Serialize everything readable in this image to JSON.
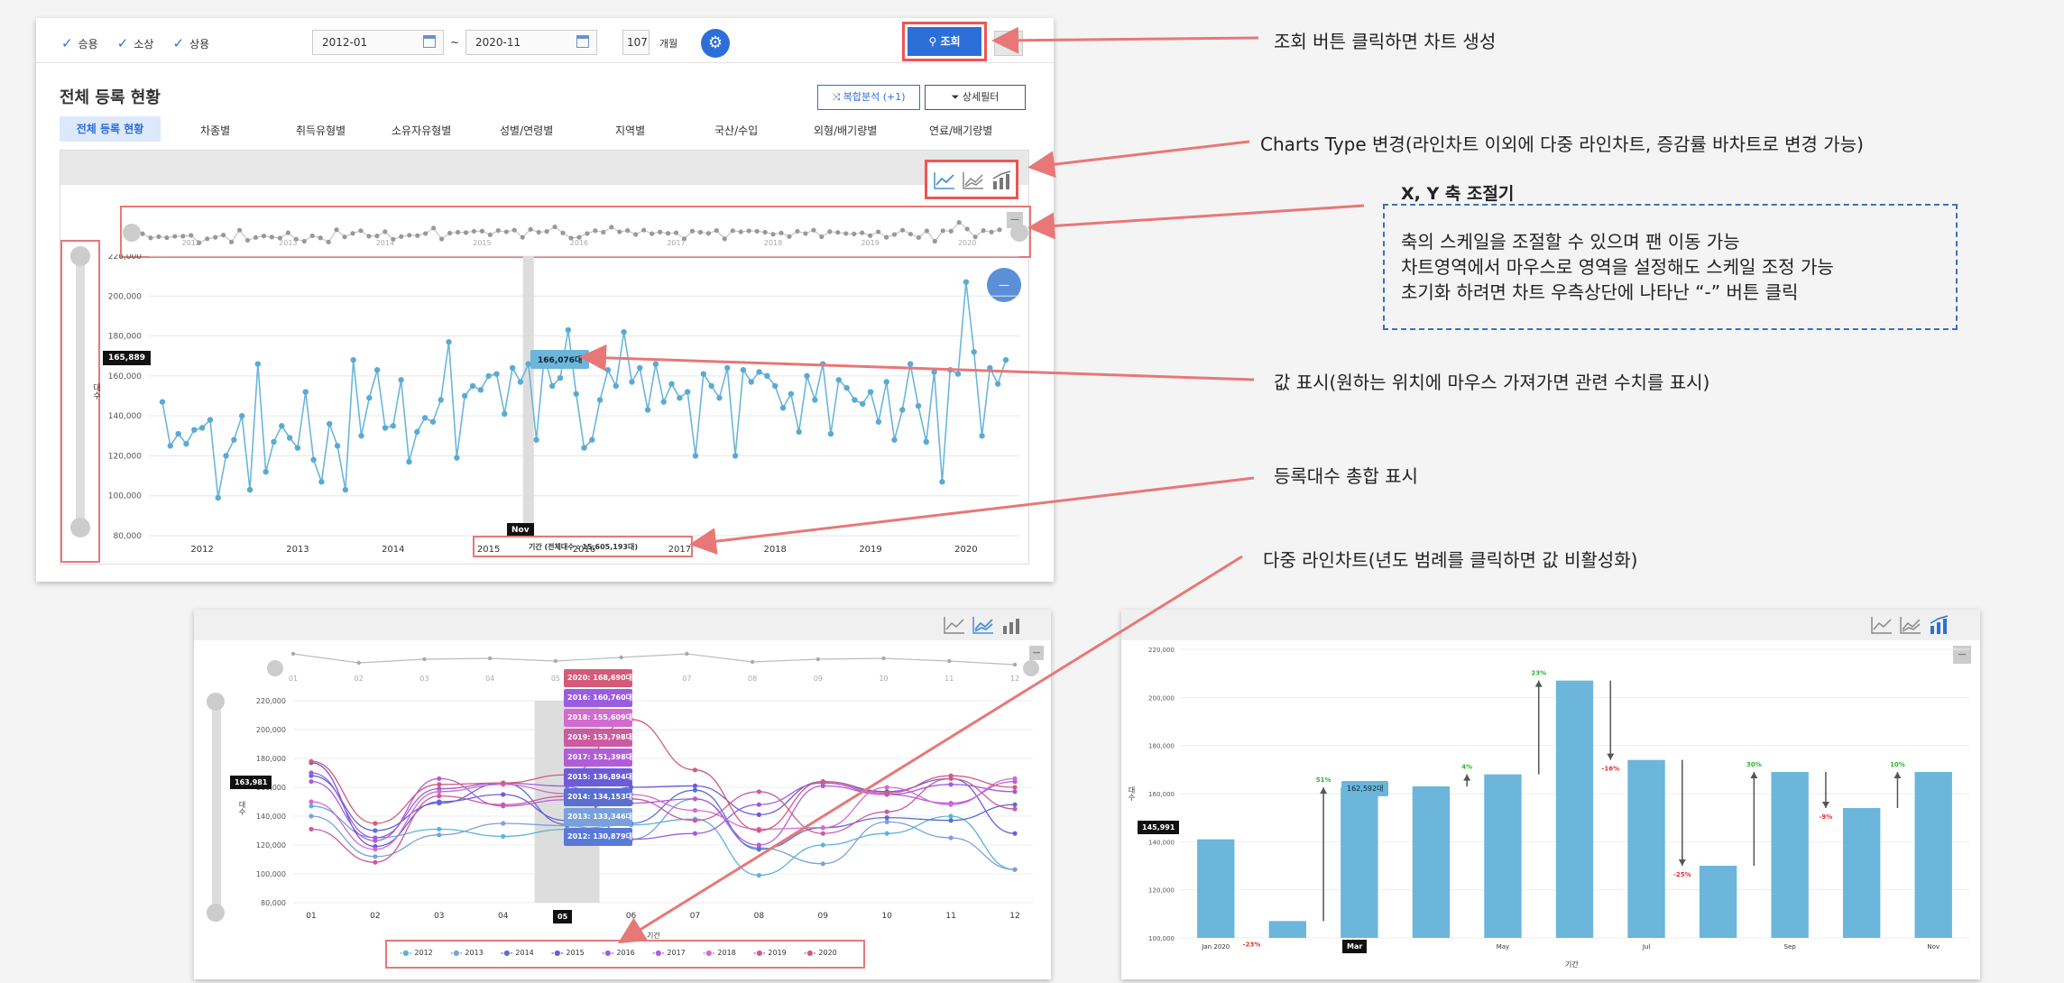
{
  "filters": {
    "checkboxes": [
      "승용",
      "소상",
      "상용"
    ],
    "start_date": "2012-01",
    "tilde": "~",
    "end_date": "2020-11",
    "months_value": "107",
    "months_unit": "개월",
    "search_label": "조회",
    "accent": "#2d6fd8"
  },
  "panel": {
    "title": "전체 등록 현황",
    "compound_label": "복합분석 (+1)",
    "detail_filter_label": "상세필터",
    "tabs": [
      "전체 등록 현황",
      "차종별",
      "취득유형별",
      "소유자유형별",
      "성별/연령별",
      "지역별",
      "국산/수입",
      "외형/배기량별",
      "연료/배기량별"
    ]
  },
  "main_chart": {
    "y_ticks": [
      "220,000",
      "200,000",
      "180,000",
      "160,000",
      "140,000",
      "120,000",
      "100,000",
      "80,000"
    ],
    "x_ticks": [
      "2012",
      "2013",
      "2014",
      "2015",
      "2016",
      "2017",
      "2018",
      "2019",
      "2020"
    ],
    "nav_labels": [
      "2012",
      "2013",
      "2014",
      "2015",
      "2016",
      "2017",
      "2018",
      "2019",
      "2020"
    ],
    "cursor_label": "Nov",
    "y_cursor_value": "165,889",
    "tooltip": "166,076대",
    "y_axis_title": "대수",
    "x_axis_title": "기간 (전체대수 : 15,605,193대)",
    "reset_symbol": "—"
  },
  "multi_chart": {
    "y_ticks": [
      "220,000",
      "200,000",
      "180,000",
      "160,000",
      "140,000",
      "120,000",
      "100,000",
      "80,000"
    ],
    "x_ticks": [
      "01",
      "02",
      "03",
      "04",
      "05",
      "06",
      "07",
      "08",
      "09",
      "10",
      "11",
      "12"
    ],
    "cursor_label": "05",
    "y_cursor_value": "163,981",
    "x_axis_title": "기간",
    "y_axis_title": "대수",
    "tooltips": [
      "2020: 168,690대",
      "2016: 160,760대",
      "2018: 155,609대",
      "2019: 153,798대",
      "2017: 151,398대",
      "2015: 136,894대",
      "2014: 134,153대",
      "2013: 133,346대",
      "2012: 130,879대"
    ],
    "legend": [
      "2012",
      "2013",
      "2014",
      "2015",
      "2016",
      "2017",
      "2018",
      "2019",
      "2020"
    ],
    "reset_symbol": "—"
  },
  "bar_chart_panel": {
    "y_ticks": [
      "220,000",
      "200,000",
      "180,000",
      "160,000",
      "140,000",
      "120,000",
      "100,000"
    ],
    "x_ticks": [
      "Jan 2020",
      "Mar",
      "May",
      "Jul",
      "Sep",
      "Nov"
    ],
    "cursor_label": "Mar",
    "y_cursor_value": "145,991",
    "tooltip": "162,592대",
    "x_axis_title": "기간",
    "y_axis_title": "대수",
    "reset_symbol": "—"
  },
  "annotations": {
    "search_note": "조회 버튼 클릭하면 차트 생성",
    "chart_type_note": "Charts Type 변경(라인차트 이외에 다중 라인차트, 증감률 바차트로 변경 가능)",
    "axis_title": "X, Y 축 조절기",
    "axis_lines": [
      "축의 스케일을 조절할 수 있으며 팬 이동 가능",
      "차트영역에서 마우스로 영역을 설정해도 스케일 조정 가능",
      "초기화 하려면 차트 우측상단에 나타난 “-” 버튼 클릭"
    ],
    "value_note": "값 표시(원하는 위치에 마우스 가져가면 관련 수치를 표시)",
    "total_note": "등록대수 총합 표시",
    "multi_note": "다중 라인차트(년도 범례를 클릭하면 값 비활성화)"
  },
  "chart_data": [
    {
      "type": "line",
      "title": "",
      "x": [
        "2012-01",
        "2012-02",
        "2012-03",
        "2012-04",
        "2012-05",
        "2012-06",
        "2012-07",
        "2012-08",
        "2012-09",
        "2012-10",
        "2012-11",
        "2012-12",
        "2013-01",
        "2013-02",
        "2013-03",
        "2013-04",
        "2013-05",
        "2013-06",
        "2013-07",
        "2013-08",
        "2013-09",
        "2013-10",
        "2013-11",
        "2013-12",
        "2014-01",
        "2014-02",
        "2014-03",
        "2014-04",
        "2014-05",
        "2014-06",
        "2014-07",
        "2014-08",
        "2014-09",
        "2014-10",
        "2014-11",
        "2014-12",
        "2015-01",
        "2015-02",
        "2015-03",
        "2015-04",
        "2015-05",
        "2015-06",
        "2015-07",
        "2015-08",
        "2015-09",
        "2015-10",
        "2015-11",
        "2015-12",
        "2016-01",
        "2016-02",
        "2016-03",
        "2016-04",
        "2016-05",
        "2016-06",
        "2016-07",
        "2016-08",
        "2016-09",
        "2016-10",
        "2016-11",
        "2016-12",
        "2017-01",
        "2017-02",
        "2017-03",
        "2017-04",
        "2017-05",
        "2017-06",
        "2017-07",
        "2017-08",
        "2017-09",
        "2017-10",
        "2017-11",
        "2017-12",
        "2018-01",
        "2018-02",
        "2018-03",
        "2018-04",
        "2018-05",
        "2018-06",
        "2018-07",
        "2018-08",
        "2018-09",
        "2018-10",
        "2018-11",
        "2018-12",
        "2019-01",
        "2019-02",
        "2019-03",
        "2019-04",
        "2019-05",
        "2019-06",
        "2019-07",
        "2019-08",
        "2019-09",
        "2019-10",
        "2019-11",
        "2019-12",
        "2020-01",
        "2020-02",
        "2020-03",
        "2020-04",
        "2020-05",
        "2020-06",
        "2020-07",
        "2020-08",
        "2020-09",
        "2020-10",
        "2020-11"
      ],
      "values": [
        147000,
        125000,
        131000,
        126000,
        133000,
        134000,
        138000,
        99000,
        120000,
        128000,
        140000,
        103000,
        166000,
        112000,
        127000,
        135000,
        129000,
        124000,
        152000,
        118000,
        107000,
        136000,
        125000,
        103000,
        168000,
        130000,
        149000,
        163000,
        134000,
        135000,
        158000,
        117000,
        132000,
        139000,
        137000,
        148000,
        177000,
        119000,
        150000,
        155000,
        153000,
        160000,
        161000,
        141000,
        164000,
        157000,
        166000,
        128000,
        170000,
        155000,
        159000,
        183000,
        151000,
        124000,
        128000,
        148000,
        163000,
        155000,
        182000,
        157000,
        164000,
        143000,
        166000,
        147000,
        156000,
        149000,
        152000,
        120000,
        161000,
        155000,
        149000,
        164000,
        120000,
        163000,
        157000,
        162000,
        160000,
        155000,
        144000,
        151000,
        132000,
        160000,
        148000,
        166000,
        131000,
        158000,
        154000,
        148000,
        146000,
        152000,
        137000,
        157000,
        128000,
        143000,
        166000,
        145000,
        127000,
        162000,
        107000,
        163000,
        161000,
        207000,
        172000,
        130000,
        164000,
        156000,
        168000
      ],
      "xlabel": "기간 (전체대수 : 15,605,193대)",
      "ylabel": "대수",
      "ylim": [
        80000,
        220000
      ],
      "grid": true
    },
    {
      "type": "line",
      "categories": [
        "01",
        "02",
        "03",
        "04",
        "05",
        "06",
        "07",
        "08",
        "09",
        "10",
        "11",
        "12"
      ],
      "series": [
        {
          "name": "2012",
          "values": [
            147000,
            125000,
            131000,
            126000,
            130879,
            134000,
            138000,
            99000,
            120000,
            128000,
            140000,
            103000
          ]
        },
        {
          "name": "2013",
          "values": [
            140000,
            112000,
            127000,
            135000,
            133346,
            124000,
            152000,
            118000,
            107000,
            136000,
            125000,
            103000
          ]
        },
        {
          "name": "2014",
          "values": [
            168000,
            130000,
            149000,
            163000,
            134153,
            135000,
            158000,
            117000,
            132000,
            139000,
            137000,
            148000
          ]
        },
        {
          "name": "2015",
          "values": [
            177000,
            119000,
            150000,
            155000,
            136894,
            160000,
            161000,
            141000,
            164000,
            157000,
            166000,
            128000
          ]
        },
        {
          "name": "2016",
          "values": [
            170000,
            125000,
            159000,
            163000,
            160760,
            124000,
            128000,
            148000,
            163000,
            155000,
            162000,
            157000
          ]
        },
        {
          "name": "2017",
          "values": [
            164000,
            123000,
            166000,
            147000,
            151398,
            149000,
            152000,
            120000,
            161000,
            155000,
            149000,
            164000
          ]
        },
        {
          "name": "2018",
          "values": [
            150000,
            117000,
            157000,
            162000,
            155609,
            155000,
            144000,
            131000,
            132000,
            160000,
            148000,
            166000
          ]
        },
        {
          "name": "2019",
          "values": [
            131000,
            108000,
            154000,
            148000,
            153798,
            152000,
            137000,
            157000,
            128000,
            143000,
            166000,
            145000
          ]
        },
        {
          "name": "2020",
          "values": [
            178000,
            135000,
            162000,
            163000,
            168690,
            207000,
            172000,
            130000,
            164000,
            156000,
            168000,
            160000
          ]
        }
      ],
      "xlabel": "기간",
      "ylabel": "대수",
      "ylim": [
        80000,
        220000
      ]
    },
    {
      "type": "bar",
      "categories": [
        "Jan",
        "Feb",
        "Mar",
        "Apr",
        "May",
        "Jun",
        "Jul",
        "Aug",
        "Sep",
        "Oct",
        "Nov"
      ],
      "values": [
        141000,
        107000,
        162592,
        163000,
        168000,
        207000,
        174000,
        130000,
        169000,
        154000,
        169000
      ],
      "change_labels": [
        "-23%",
        "",
        "51%",
        "",
        "4%",
        "23%",
        "-16%",
        "-25%",
        "30%",
        "-9%",
        "10%"
      ],
      "xlabel": "기간",
      "ylabel": "대수",
      "ylim": [
        100000,
        220000
      ]
    }
  ]
}
